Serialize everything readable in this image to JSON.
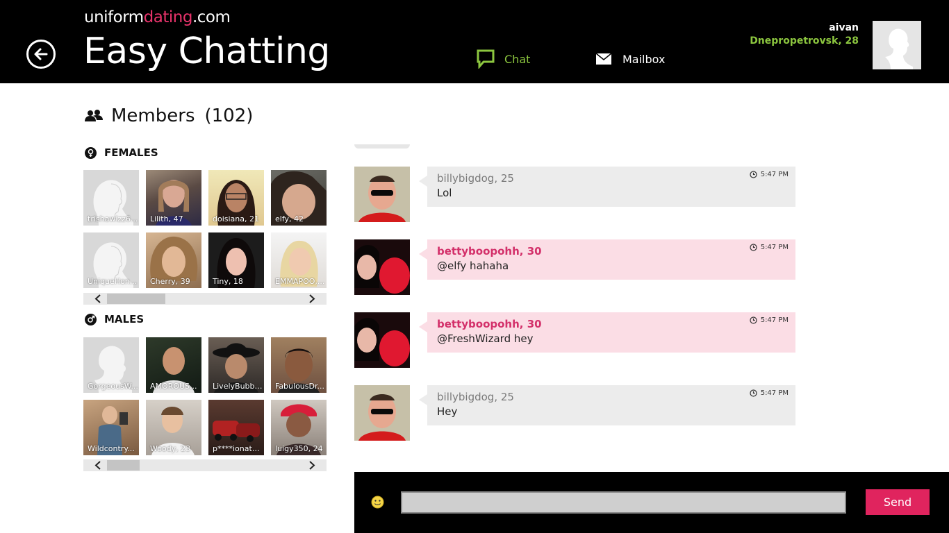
{
  "header": {
    "brand_prefix": "uniform",
    "brand_accent": "dating",
    "brand_suffix": ".com",
    "title": "Easy Chatting",
    "nav": {
      "chat": "Chat",
      "mailbox": "Mailbox"
    },
    "user": {
      "name": "aivan",
      "location": "Dnepropetrovsk, 28"
    }
  },
  "members": {
    "title": "Members",
    "count": "(102)",
    "females_label": "FEMALES",
    "males_label": "MALES",
    "females": [
      {
        "caption": "trishawizz6...",
        "photo": "silhouette-female"
      },
      {
        "caption": "Lilith, 47",
        "photo": "photo"
      },
      {
        "caption": "doisiana, 21",
        "photo": "photo"
      },
      {
        "caption": "elfy, 42",
        "photo": "photo"
      },
      {
        "caption": "UniqueHon...",
        "photo": "silhouette-female"
      },
      {
        "caption": "Cherry, 39",
        "photo": "photo"
      },
      {
        "caption": "Tiny, 18",
        "photo": "photo"
      },
      {
        "caption": "EMMAPOO,...",
        "photo": "photo"
      }
    ],
    "males": [
      {
        "caption": "GorgeousW...",
        "photo": "silhouette-male"
      },
      {
        "caption": "AMOROUS...",
        "photo": "photo"
      },
      {
        "caption": "LivelyBubbl...",
        "photo": "photo"
      },
      {
        "caption": "FabulousDr...",
        "photo": "photo"
      },
      {
        "caption": "Wildcontry...",
        "photo": "photo"
      },
      {
        "caption": "Woody, 23",
        "photo": "photo"
      },
      {
        "caption": "p****ionate...",
        "photo": "photo"
      },
      {
        "caption": "luigy350, 24",
        "photo": "photo"
      }
    ]
  },
  "messages": [
    {
      "sender": "billybigdog, 25",
      "text": "Lol",
      "time": "5:47 PM",
      "style": "grey"
    },
    {
      "sender": "bettyboopohh, 30",
      "text": "@elfy hahaha",
      "time": "5:47 PM",
      "style": "pink"
    },
    {
      "sender": "bettyboopohh, 30",
      "text": "@FreshWizard hey",
      "time": "5:47 PM",
      "style": "pink"
    },
    {
      "sender": "billybigdog, 25",
      "text": "Hey",
      "time": "5:47 PM",
      "style": "grey"
    }
  ],
  "compose": {
    "input_value": "",
    "send_label": "Send"
  },
  "colors": {
    "accent_pink": "#e0245e",
    "accent_green": "#8cc63f",
    "header_bg": "#000000"
  }
}
